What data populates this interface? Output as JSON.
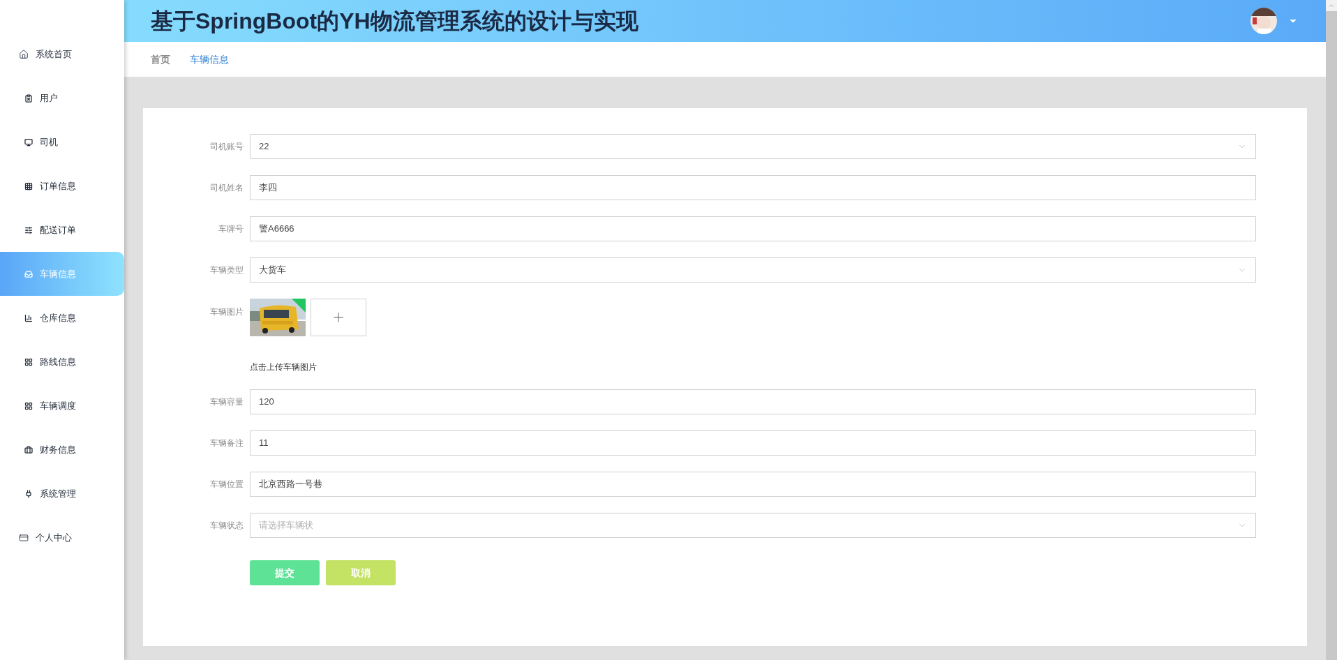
{
  "header": {
    "title": "基于SpringBoot的YH物流管理系统的设计与实现"
  },
  "breadcrumbs": [
    {
      "label": "首页",
      "selected": false
    },
    {
      "label": "车辆信息",
      "selected": true
    }
  ],
  "sidebar": {
    "items": [
      {
        "label": "系统首页",
        "kind": "top",
        "selected": false
      },
      {
        "label": "用户",
        "kind": "sub",
        "selected": false
      },
      {
        "label": "司机",
        "kind": "sub",
        "selected": false
      },
      {
        "label": "订单信息",
        "kind": "sub",
        "selected": false
      },
      {
        "label": "配送订单",
        "kind": "sub",
        "selected": false
      },
      {
        "label": "车辆信息",
        "kind": "sub",
        "selected": true
      },
      {
        "label": "仓库信息",
        "kind": "sub",
        "selected": false
      },
      {
        "label": "路线信息",
        "kind": "sub",
        "selected": false
      },
      {
        "label": "车辆调度",
        "kind": "sub",
        "selected": false
      },
      {
        "label": "财务信息",
        "kind": "sub",
        "selected": false
      },
      {
        "label": "系统管理",
        "kind": "sub",
        "selected": false
      },
      {
        "label": "个人中心",
        "kind": "top",
        "selected": false
      }
    ]
  },
  "form": {
    "fields": [
      {
        "kind": "select",
        "label": "司机账号",
        "value": "22"
      },
      {
        "kind": "text",
        "label": "司机姓名",
        "value": "李四"
      },
      {
        "kind": "text",
        "label": "车牌号",
        "value": "警A6666"
      },
      {
        "kind": "select",
        "label": "车辆类型",
        "value": "大货车"
      },
      {
        "kind": "upload",
        "label": "车辆图片",
        "hint": "点击上传车辆图片"
      },
      {
        "kind": "text",
        "label": "车辆容量",
        "value": "120"
      },
      {
        "kind": "text",
        "label": "车辆备注",
        "value": "11"
      },
      {
        "kind": "text",
        "label": "车辆位置",
        "value": "北京西路一号巷"
      },
      {
        "kind": "select",
        "label": "车辆状态",
        "placeholder": "请选择车辆状"
      }
    ],
    "buttons": [
      {
        "label": "提交",
        "color": "#5ee396"
      },
      {
        "label": "取消",
        "color": "#c4e263"
      }
    ]
  }
}
